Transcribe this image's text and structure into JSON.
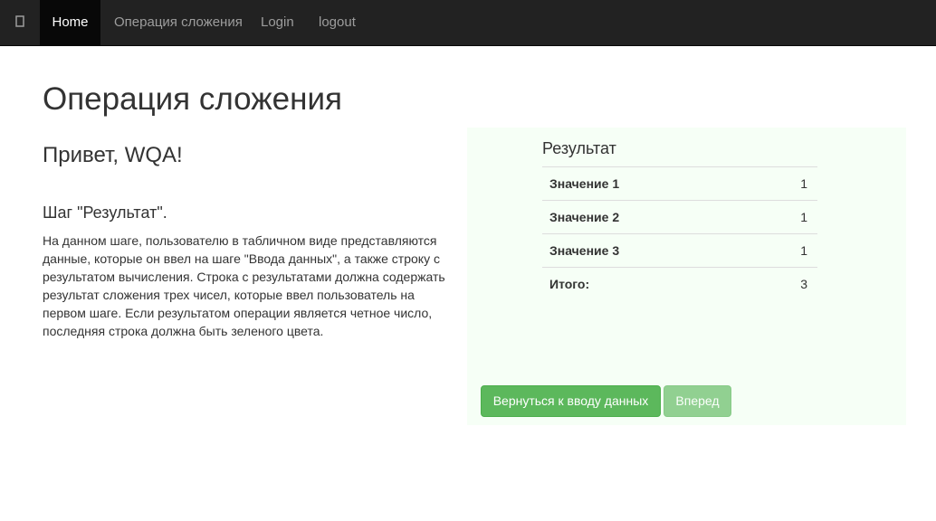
{
  "navbar": {
    "brand_icon": "app-icon",
    "items": [
      {
        "label": "Home",
        "active": true
      },
      {
        "label": "Операция сложения"
      },
      {
        "label": "Login"
      },
      {
        "label": "logout"
      }
    ],
    "colors": {
      "background": "#222222",
      "active_background": "#080808",
      "text": "#9d9d9d",
      "active_text": "#ffffff"
    }
  },
  "main": {
    "title": "Операция сложения",
    "greeting": "Привет, WQA!",
    "step_title": "Шаг \"Результат\".",
    "description": "На данном шаге, пользователю в табличном виде представляются данные, которые он ввел на шаге \"Ввода данных\", а также строку с результатом вычисления. Строка с результатами должна содержать результат сложения трех чисел, которые ввел пользователь на первом шаге. Если результатом операции является четное число, последняя строка должна быть зеленого цвета."
  },
  "result": {
    "caption": "Результат",
    "rows": [
      {
        "label": "Значение 1",
        "value": "1"
      },
      {
        "label": "Значение 2",
        "value": "1"
      },
      {
        "label": "Значение 3",
        "value": "1"
      },
      {
        "label": "Итого:",
        "value": "3"
      }
    ],
    "panel_color": "#f6fff6"
  },
  "actions": {
    "back_label": "Вернуться к вводу данных",
    "next_label": "Вперед",
    "button_color": "#5cb85c"
  }
}
